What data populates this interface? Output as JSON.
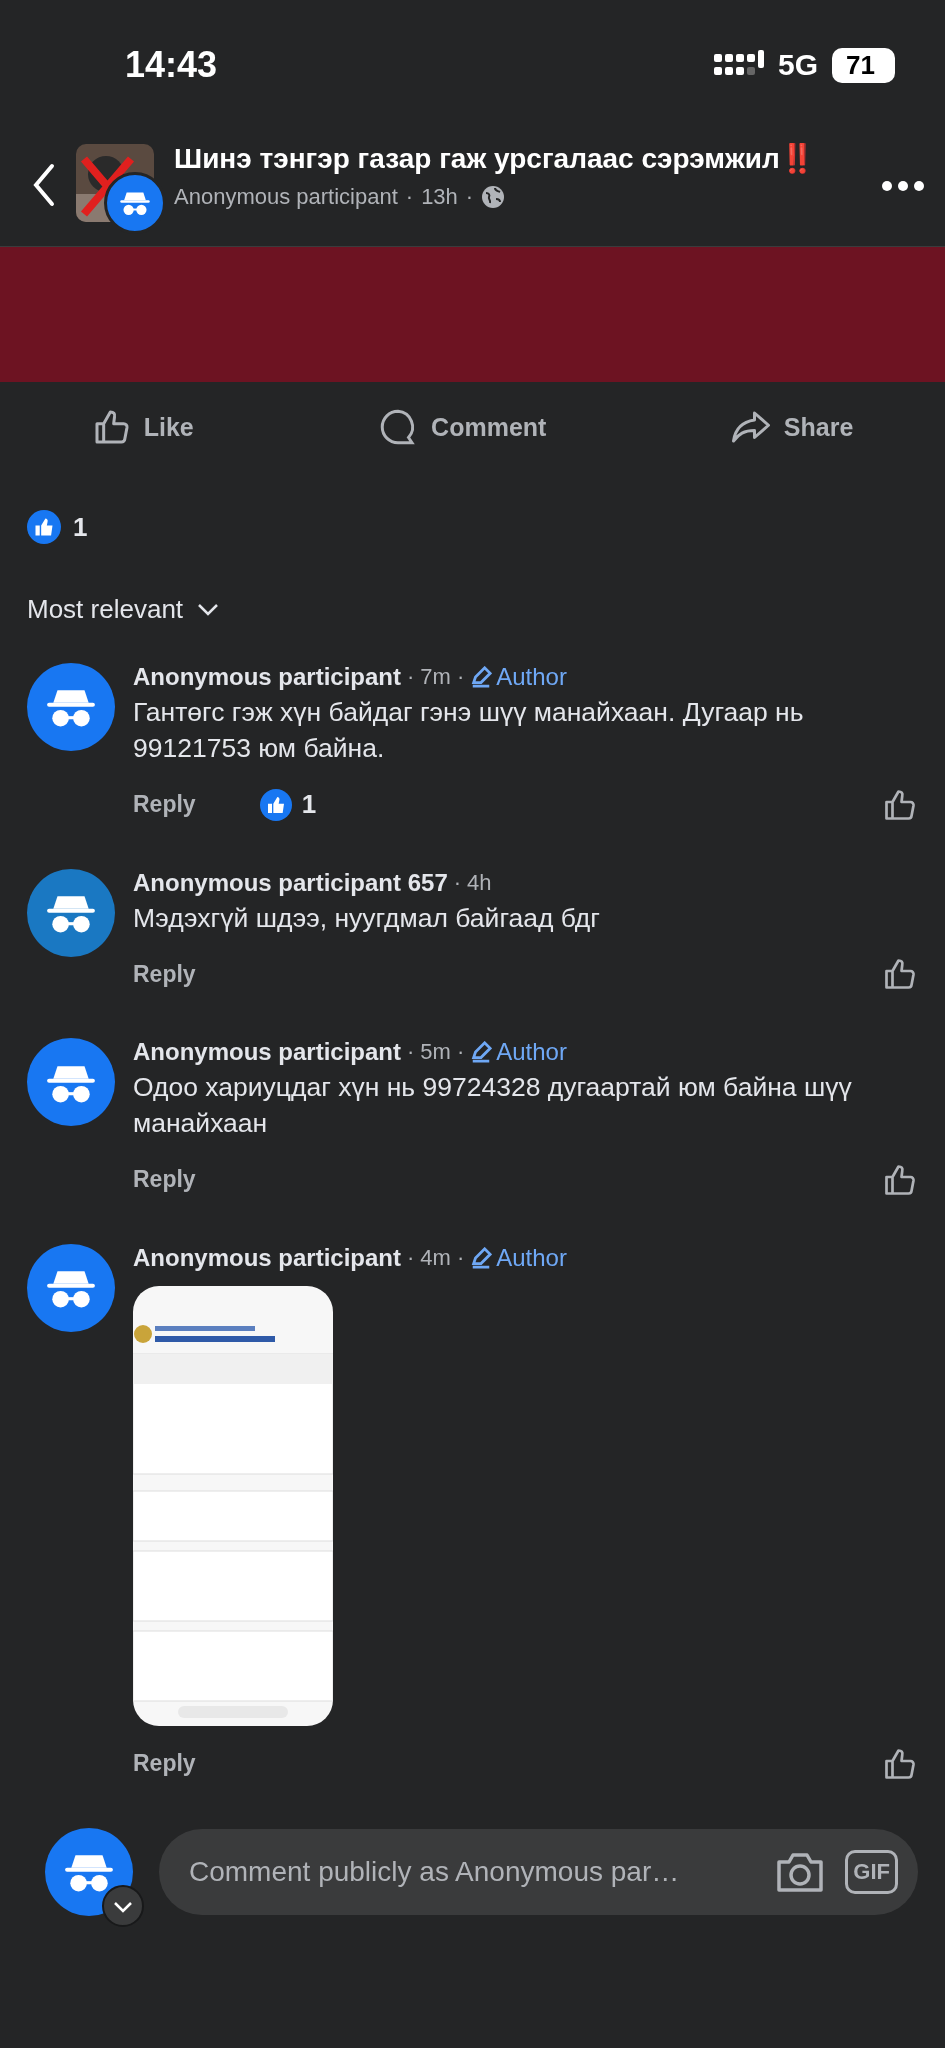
{
  "status_bar": {
    "time": "14:43",
    "network": "5G",
    "battery": "71"
  },
  "separator": "·",
  "post": {
    "title": "Шинэ тэнгэр газар гаж урсгалаас сэрэмжил",
    "title_mark": "‼️",
    "author": "Anonymous participant",
    "time": "13h"
  },
  "actions": [
    {
      "kind": "like",
      "label": "Like"
    },
    {
      "kind": "comment",
      "label": "Comment"
    },
    {
      "kind": "share",
      "label": "Share"
    }
  ],
  "reactions": {
    "count": "1"
  },
  "sort": {
    "label": "Most relevant"
  },
  "comments": [
    {
      "kind": "text",
      "author": "Anonymous participant",
      "time": "7m",
      "badge": "Author",
      "color": "#1877f2",
      "text": "Гантөгс гэж хүн байдаг гэнэ шүү манайхаан. Дугаар нь 99121753 юм байна.",
      "reply": "Reply",
      "reaction_count": "1"
    },
    {
      "kind": "text",
      "author": "Anonymous participant 657",
      "time": "4h",
      "color": "#1a78c2",
      "text": "Мэдэхгүй шдээ, нуугдмал байгаад бдг",
      "reply": "Reply"
    },
    {
      "kind": "text",
      "author": "Anonymous participant",
      "time": "5m",
      "badge": "Author",
      "color": "#1877f2",
      "text": "Одоо хариуцдаг хүн нь 99724328 дугаартай юм байна шүү манайхаан",
      "reply": "Reply"
    },
    {
      "author": "Anonymous participant",
      "time": "4m",
      "badge": "Author",
      "color": "#1877f2",
      "reply": "Reply"
    }
  ],
  "composer": {
    "placeholder": "Comment publicly as Anonymous par…",
    "gif": "GIF"
  }
}
